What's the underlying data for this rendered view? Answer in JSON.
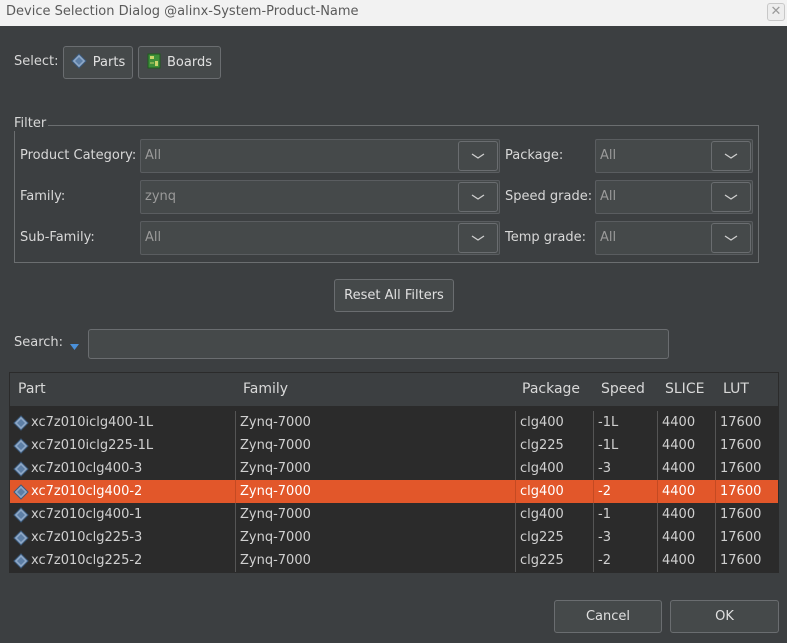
{
  "window": {
    "title": "Device Selection Dialog @alinx-System-Product-Name"
  },
  "select": {
    "label": "Select:",
    "parts_label": "Parts",
    "boards_label": "Boards"
  },
  "filter": {
    "legend": "Filter",
    "product_category": {
      "label": "Product Category:",
      "value": "All"
    },
    "family": {
      "label": "Family:",
      "value": "zynq"
    },
    "sub_family": {
      "label": "Sub-Family:",
      "value": "All"
    },
    "package": {
      "label": "Package:",
      "value": "All"
    },
    "speed_grade": {
      "label": "Speed grade:",
      "value": "All"
    },
    "temp_grade": {
      "label": "Temp grade:",
      "value": "All"
    },
    "reset_label": "Reset All Filters"
  },
  "search": {
    "label": "Search:",
    "value": ""
  },
  "table": {
    "columns": [
      "Part",
      "Family",
      "Package",
      "Speed",
      "SLICE",
      "LUT"
    ],
    "rows": [
      {
        "part": "xc7z010iclg400-1L",
        "family": "Zynq-7000",
        "package": "clg400",
        "speed": "-1L",
        "slice": "4400",
        "lut": "17600"
      },
      {
        "part": "xc7z010iclg225-1L",
        "family": "Zynq-7000",
        "package": "clg225",
        "speed": "-1L",
        "slice": "4400",
        "lut": "17600"
      },
      {
        "part": "xc7z010clg400-3",
        "family": "Zynq-7000",
        "package": "clg400",
        "speed": "-3",
        "slice": "4400",
        "lut": "17600"
      },
      {
        "part": "xc7z010clg400-2",
        "family": "Zynq-7000",
        "package": "clg400",
        "speed": "-2",
        "slice": "4400",
        "lut": "17600"
      },
      {
        "part": "xc7z010clg400-1",
        "family": "Zynq-7000",
        "package": "clg400",
        "speed": "-1",
        "slice": "4400",
        "lut": "17600"
      },
      {
        "part": "xc7z010clg225-3",
        "family": "Zynq-7000",
        "package": "clg225",
        "speed": "-3",
        "slice": "4400",
        "lut": "17600"
      },
      {
        "part": "xc7z010clg225-2",
        "family": "Zynq-7000",
        "package": "clg225",
        "speed": "-2",
        "slice": "4400",
        "lut": "17600"
      }
    ],
    "selected_index": 3,
    "selection_color": "#e2572a"
  },
  "footer": {
    "cancel_label": "Cancel",
    "ok_label": "OK"
  },
  "icons": {
    "close": "close-icon",
    "parts": "chip-icon",
    "boards": "board-icon",
    "dropdown": "chevron-down-icon",
    "search_options": "triangle-down-icon"
  }
}
